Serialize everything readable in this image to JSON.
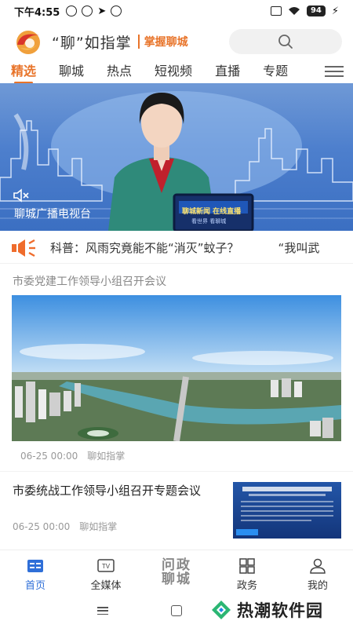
{
  "status_bar": {
    "time": "下午4:55",
    "battery": "94"
  },
  "header": {
    "app_name": "“聊”如指掌",
    "slogan": "掌握聊城"
  },
  "tabs": [
    "精选",
    "聊城",
    "热点",
    "短视频",
    "直播",
    "专题"
  ],
  "active_tab": "精选",
  "banner": {
    "caption": "聊城广播电视台",
    "screen_text": "聊城新闻 在线直播",
    "screen_sub": "看世界 看聊城"
  },
  "ticker": {
    "text": "科普：风雨究竟能不能“消灭”蚊子？",
    "next_text": "“我叫武"
  },
  "articles": [
    {
      "title": "市委党建工作领导小组召开会议",
      "date": "06-25 00:00",
      "source": "聊如指掌"
    },
    {
      "title": "市委统战工作领导小组召开专题会议",
      "date": "06-25 00:00",
      "source": "聊如指掌"
    }
  ],
  "bottom_nav": {
    "items": [
      {
        "label": "首页",
        "icon": "news-icon"
      },
      {
        "label": "全媒体",
        "icon": "tv-icon"
      },
      {
        "label": "问政聊城",
        "icon": "wenzheng-text"
      },
      {
        "label": "政务",
        "icon": "grid-icon"
      },
      {
        "label": "我的",
        "icon": "user-icon"
      }
    ],
    "center_line1": "问政",
    "center_line2": "聊城"
  },
  "watermark": {
    "text": "热潮软件园"
  },
  "colors": {
    "accent": "#e8742a",
    "nav_active": "#2f6fd8",
    "banner_blue": "#4d7fcd"
  }
}
